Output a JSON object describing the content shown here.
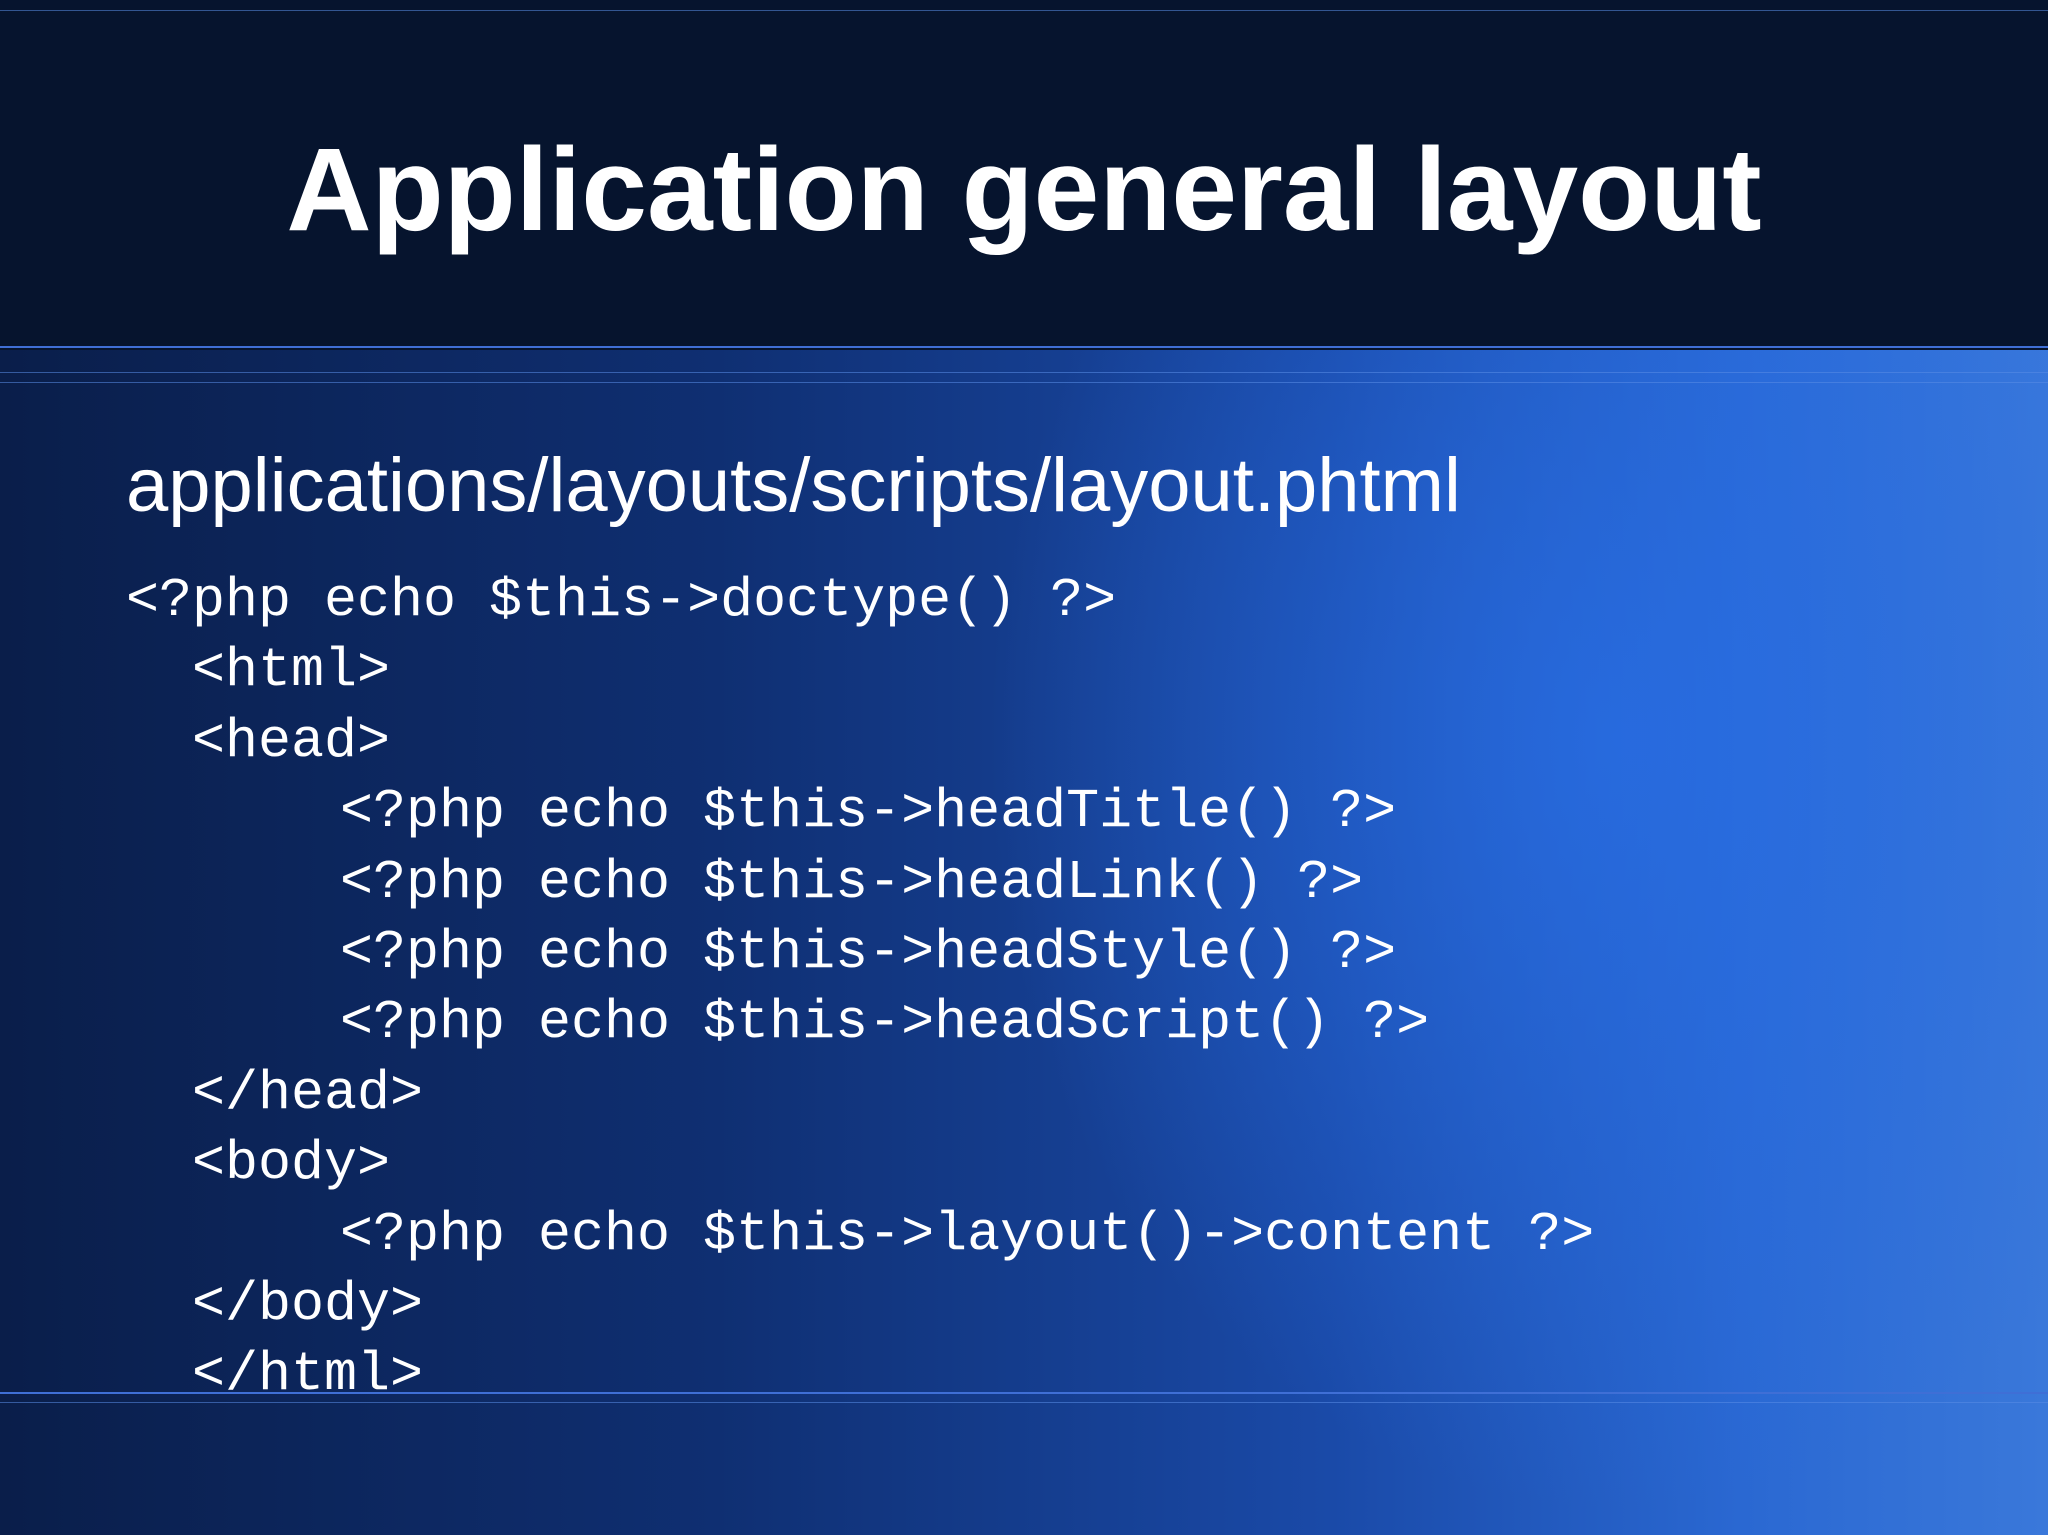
{
  "slide": {
    "title": "Application general layout",
    "subtitle": "applications/layouts/scripts/layout.phtml",
    "code_lines": [
      "<?php echo $this->doctype() ?>",
      "<html>",
      "<head>",
      "<?php echo $this->headTitle() ?>",
      "<?php echo $this->headLink() ?>",
      "<?php echo $this->headStyle() ?>",
      "<?php echo $this->headScript() ?>",
      "</head>",
      "<body>",
      "<?php echo $this->layout()->content ?>",
      "</body>",
      "</html>"
    ]
  },
  "colors": {
    "header_bg": "#06142e",
    "accent_line": "#3f6fd6",
    "text": "#ffffff",
    "gradient_dark": "#0a1e4a",
    "gradient_light": "#3a78da"
  }
}
